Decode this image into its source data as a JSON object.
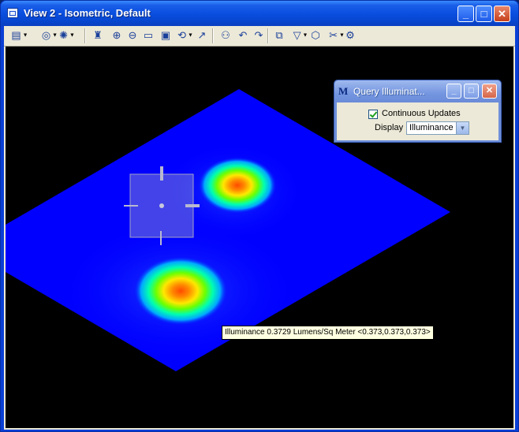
{
  "window": {
    "title": "View 2 - Isometric, Default",
    "icon": "view-window-icon",
    "controls": {
      "minimize": "minimize-icon",
      "maximize": "maximize-icon",
      "close": "close-icon"
    }
  },
  "toolbar": {
    "items": [
      {
        "name": "view-attributes-icon",
        "glyph": "▤",
        "dropdown": true
      },
      {
        "name": "render-icon",
        "glyph": "◎",
        "dropdown": true
      },
      {
        "name": "lighting-icon",
        "glyph": "✺",
        "dropdown": true
      },
      {
        "name": "update-view-icon",
        "glyph": "♜"
      },
      {
        "name": "zoom-in-icon",
        "glyph": "⊕"
      },
      {
        "name": "zoom-out-icon",
        "glyph": "⊖"
      },
      {
        "name": "window-area-icon",
        "glyph": "▭"
      },
      {
        "name": "fit-view-icon",
        "glyph": "▣"
      },
      {
        "name": "rotate-view-icon",
        "glyph": "⟲",
        "dropdown": true
      },
      {
        "name": "pan-view-icon",
        "glyph": "↗"
      },
      {
        "name": "walk-icon",
        "glyph": "⚇"
      },
      {
        "name": "view-previous-icon",
        "glyph": "↶"
      },
      {
        "name": "view-next-icon",
        "glyph": "↷"
      },
      {
        "name": "copy-view-icon",
        "glyph": "⧉"
      },
      {
        "name": "clip-volume-icon",
        "glyph": "▽",
        "dropdown": true
      },
      {
        "name": "clip-mask-icon",
        "glyph": "⬡"
      },
      {
        "name": "camera-icon",
        "glyph": "✂",
        "dropdown": true
      },
      {
        "name": "view-settings-icon",
        "glyph": "⚙"
      }
    ]
  },
  "query_panel": {
    "title": "Query Illuminat...",
    "icon": "microstation-icon",
    "continuous_updates_label": "Continuous Updates",
    "continuous_updates_checked": true,
    "display_label": "Display",
    "display_value": "Illuminance"
  },
  "tooltip": {
    "text": "Illuminance 0.3729 Lumens/Sq Meter <0.373,0.373,0.373>"
  },
  "colors": {
    "floor": "#0000ff",
    "titlebar": "#0a4fe0",
    "background": "#000000"
  }
}
